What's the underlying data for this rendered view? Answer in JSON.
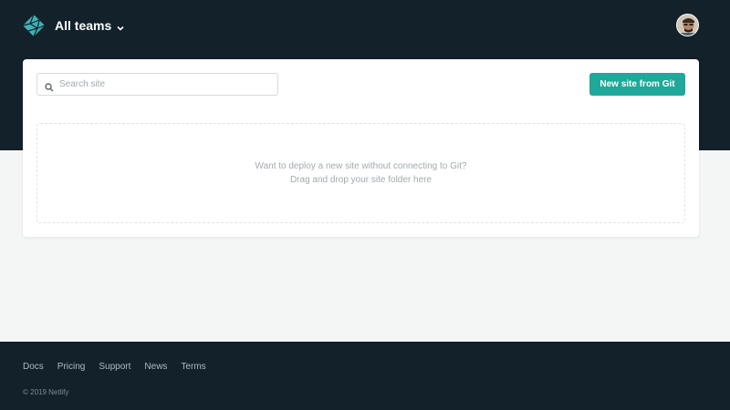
{
  "header": {
    "logo_icon": "netlify-logo-icon",
    "team_label": "All teams",
    "avatar_icon": "user-avatar"
  },
  "toolbar": {
    "search_placeholder": "Search site",
    "new_site_label": "New site from Git"
  },
  "dropzone": {
    "line1": "Want to deploy a new site without connecting to Git?",
    "line2": "Drag and drop your site folder here"
  },
  "footer": {
    "links": [
      {
        "label": "Docs"
      },
      {
        "label": "Pricing"
      },
      {
        "label": "Support"
      },
      {
        "label": "News"
      },
      {
        "label": "Terms"
      }
    ],
    "copyright": "© 2019 Netlify"
  },
  "colors": {
    "header_bg": "#12212a",
    "accent": "#20a89a",
    "page_bg": "#f4f6f6",
    "logo": "#3eb2b5"
  }
}
